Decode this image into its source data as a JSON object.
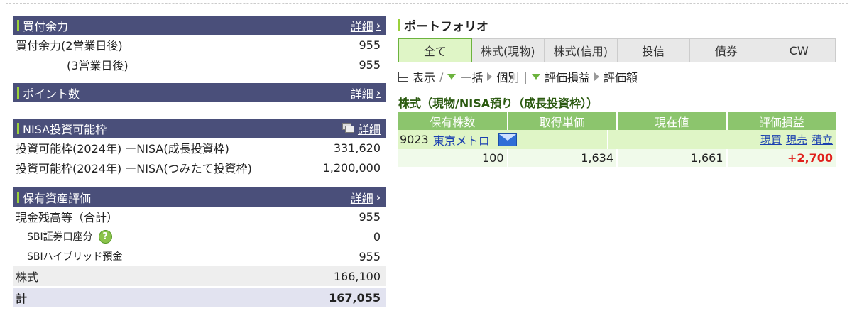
{
  "buying_power": {
    "title": "買付余力",
    "detail": "詳細",
    "rows": [
      {
        "label": "買付余力(2営業日後)",
        "value": "955"
      },
      {
        "label": "(3営業日後)",
        "value": "955"
      }
    ]
  },
  "points": {
    "title": "ポイント数",
    "detail": "詳細"
  },
  "nisa": {
    "title": "NISA投資可能枠",
    "detail": "詳細",
    "rows": [
      {
        "label": "投資可能枠(2024年) ーNISA(成長投資枠)",
        "value": "331,620"
      },
      {
        "label": "投資可能枠(2024年) ーNISA(つみたて投資枠)",
        "value": "1,200,000"
      }
    ]
  },
  "assets": {
    "title": "保有資産評価",
    "detail": "詳細",
    "cash_label": "現金残高等（合計）",
    "cash_value": "955",
    "sbi_account_label": "SBI証券口座分",
    "sbi_account_value": "0",
    "hybrid_label": "SBIハイブリッド預金",
    "hybrid_value": "955",
    "stock_label": "株式",
    "stock_value": "166,100",
    "total_label": "計",
    "total_value": "167,055"
  },
  "portfolio": {
    "title": "ポートフォリオ",
    "tabs": [
      "全て",
      "株式(現物)",
      "株式(信用)",
      "投信",
      "債券",
      "CW"
    ],
    "active_tab": 0,
    "controls": {
      "display": "表示",
      "slash": "/",
      "bulk": "一括",
      "individual": "個別",
      "bar": "|",
      "pl": "評価損益",
      "valuation": "評価額"
    },
    "section_title": "株式（現物/NISA預り（成長投資枠））",
    "headers": [
      "保有株数",
      "取得単価",
      "現在値",
      "評価損益"
    ],
    "stock": {
      "code": "9023",
      "name": "東京メトロ",
      "actions": [
        "現買",
        "現売",
        "積立"
      ],
      "shares": "100",
      "cost": "1,634",
      "price": "1,661",
      "pl": "+2,700"
    }
  },
  "colors": {
    "header_bg": "#4a4f7a",
    "accent_green": "#9bd13b",
    "table_head": "#8cc56d",
    "profit_red": "#e0201c"
  }
}
